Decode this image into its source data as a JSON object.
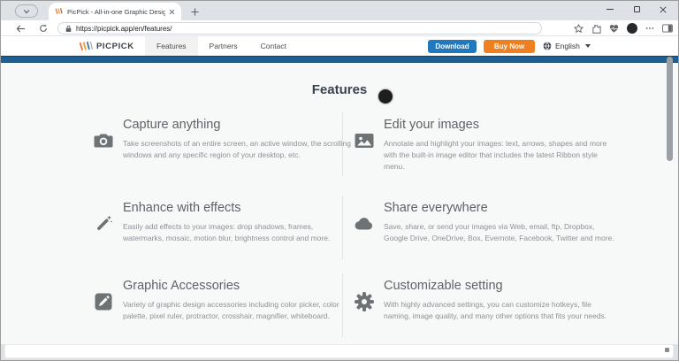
{
  "browser": {
    "tab_title": "PicPick - All-in-one Graphic Desig",
    "url": "https://picpick.app/en/features/"
  },
  "header": {
    "brand": "PICPICK",
    "nav": [
      {
        "label": "Features",
        "active": true
      },
      {
        "label": "Partners",
        "active": false
      },
      {
        "label": "Contact",
        "active": false
      }
    ],
    "download_label": "Download",
    "buy_now_label": "Buy Now",
    "language_label": "English"
  },
  "page": {
    "title": "Features",
    "features": [
      {
        "icon": "camera-icon",
        "title": "Capture anything",
        "desc": "Take screenshots of an entire screen, an active window, the scrolling windows and any specific region of your desktop, etc."
      },
      {
        "icon": "image-icon",
        "title": "Edit your images",
        "desc": "Annotate and highlight your images: text, arrows, shapes and more with the built-in image editor that includes the latest Ribbon style menu."
      },
      {
        "icon": "magic-wand-icon",
        "title": "Enhance with effects",
        "desc": "Easily add effects to your images: drop shadows, frames, watermarks, mosaic, motion blur, brightness control and more."
      },
      {
        "icon": "cloud-icon",
        "title": "Share everywhere",
        "desc": "Save, share, or send your images via Web, email, ftp, Dropbox, Google Drive, OneDrive, Box, Evernote, Facebook, Twitter and more."
      },
      {
        "icon": "pencil-icon",
        "title": "Graphic Accessories",
        "desc": "Variety of graphic design accessories including color picker, color palette, pixel ruler, protractor, crosshair, magnifier, whiteboard."
      },
      {
        "icon": "gear-icon",
        "title": "Customizable setting",
        "desc": "With highly advanced settings, you can customize hotkeys, file naming, image quality, and many other options that fits your needs."
      }
    ]
  },
  "colors": {
    "download_blue": "#2278bd",
    "buy_orange": "#f0801f",
    "banner_blue": "#1f5e92"
  }
}
